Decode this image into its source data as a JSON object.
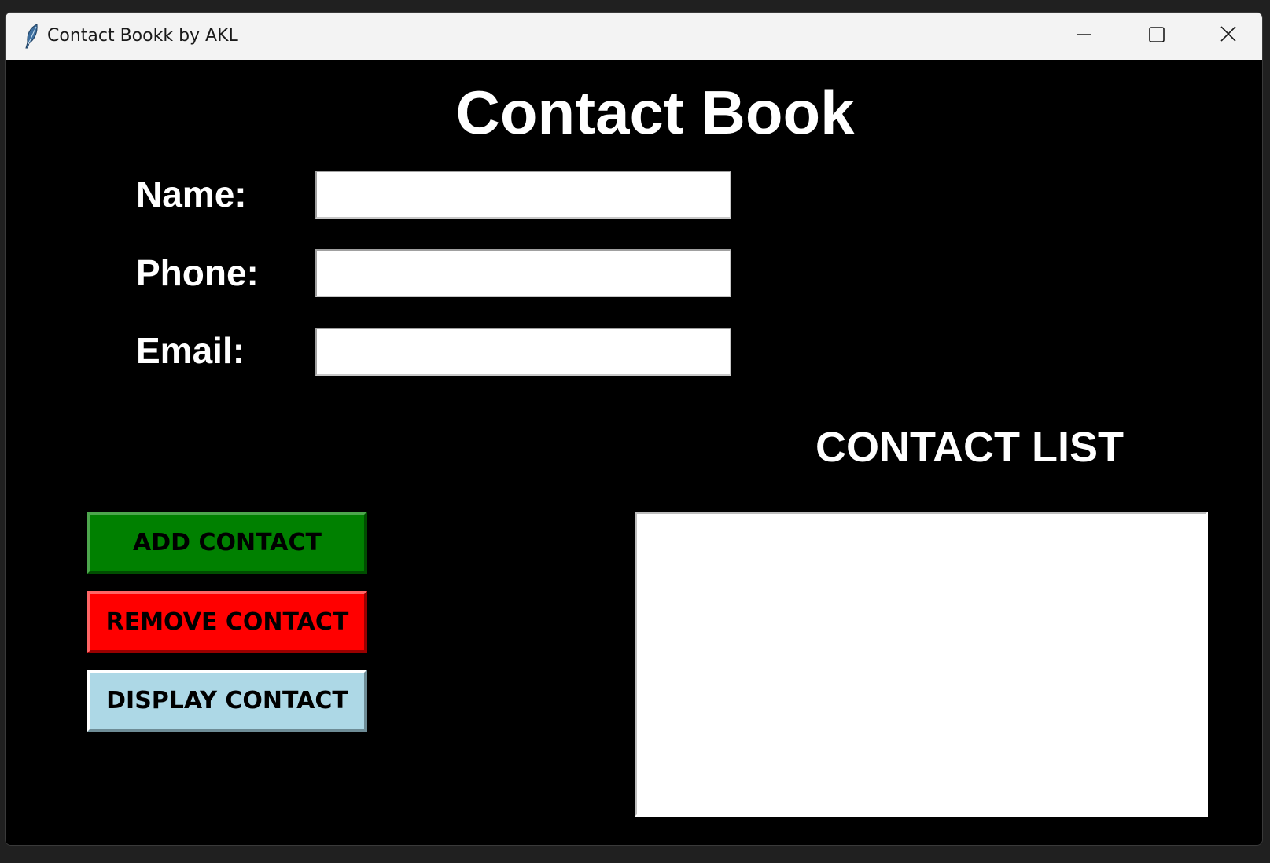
{
  "window": {
    "title": "Contact Bookk by AKL",
    "app_icon": "feather-icon",
    "controls": [
      "minimize-icon",
      "maximize-icon",
      "close-icon"
    ]
  },
  "main": {
    "heading": "Contact Book",
    "fields": {
      "name_label": "Name:",
      "name_value": "",
      "phone_label": "Phone:",
      "phone_value": "",
      "email_label": "Email:",
      "email_value": ""
    },
    "buttons": {
      "add_label": "ADD CONTACT",
      "remove_label": "REMOVE CONTACT",
      "display_label": "DISPLAY CONTACT"
    },
    "list_heading": "CONTACT LIST",
    "contacts": []
  },
  "colors": {
    "background": "#000000",
    "add_button": "#008000",
    "remove_button": "#ff0000",
    "display_button": "#add8e6"
  }
}
